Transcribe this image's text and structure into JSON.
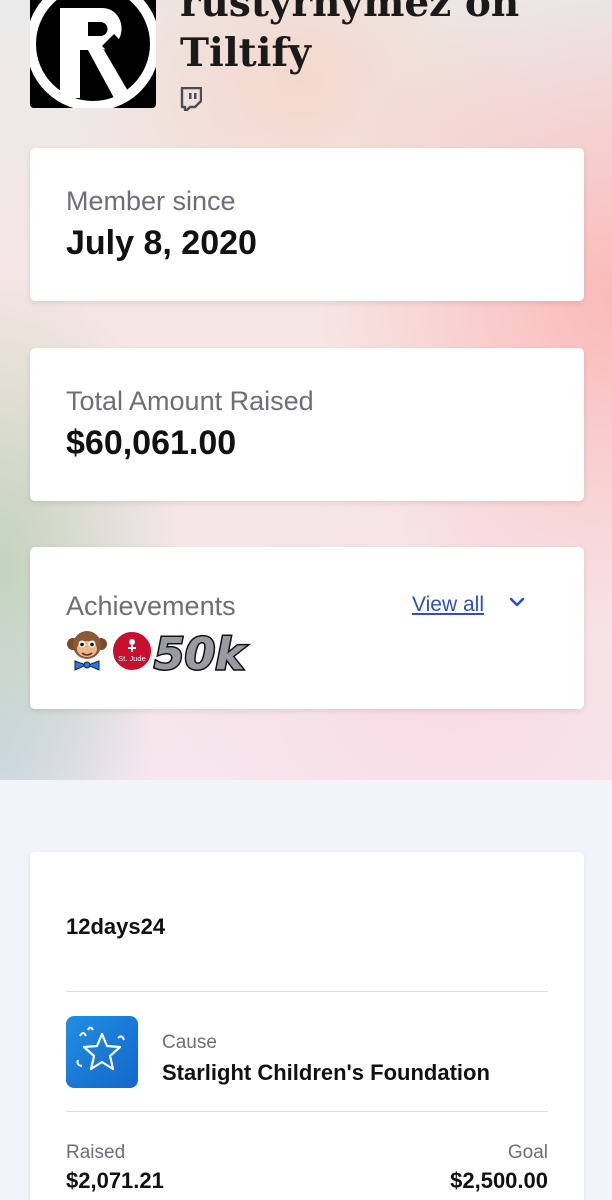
{
  "profile": {
    "title": "rustyrhymez on Tiltify",
    "platform_icon": "twitch-icon"
  },
  "member_since": {
    "label": "Member since",
    "value": "July 8, 2020"
  },
  "total_raised": {
    "label": "Total Amount Raised",
    "value": "$60,061.00"
  },
  "achievements": {
    "label": "Achievements",
    "view_all": "View all",
    "badges": [
      {
        "name": "monkey-bowtie-badge"
      },
      {
        "name": "st-jude-badge",
        "text": "St. Jude"
      },
      {
        "name": "50k-badge",
        "text": "50k"
      }
    ]
  },
  "campaign": {
    "name": "12days24",
    "cause_label": "Cause",
    "cause_name": "Starlight Children's Foundation",
    "raised_label": "Raised",
    "raised_value": "$2,071.21",
    "goal_label": "Goal",
    "goal_value": "$2,500.00"
  },
  "colors": {
    "link": "#2e4fbf",
    "twitch": "#4b4b55",
    "cause_logo": "#1a7ad6",
    "st_jude": "#c8102e"
  }
}
